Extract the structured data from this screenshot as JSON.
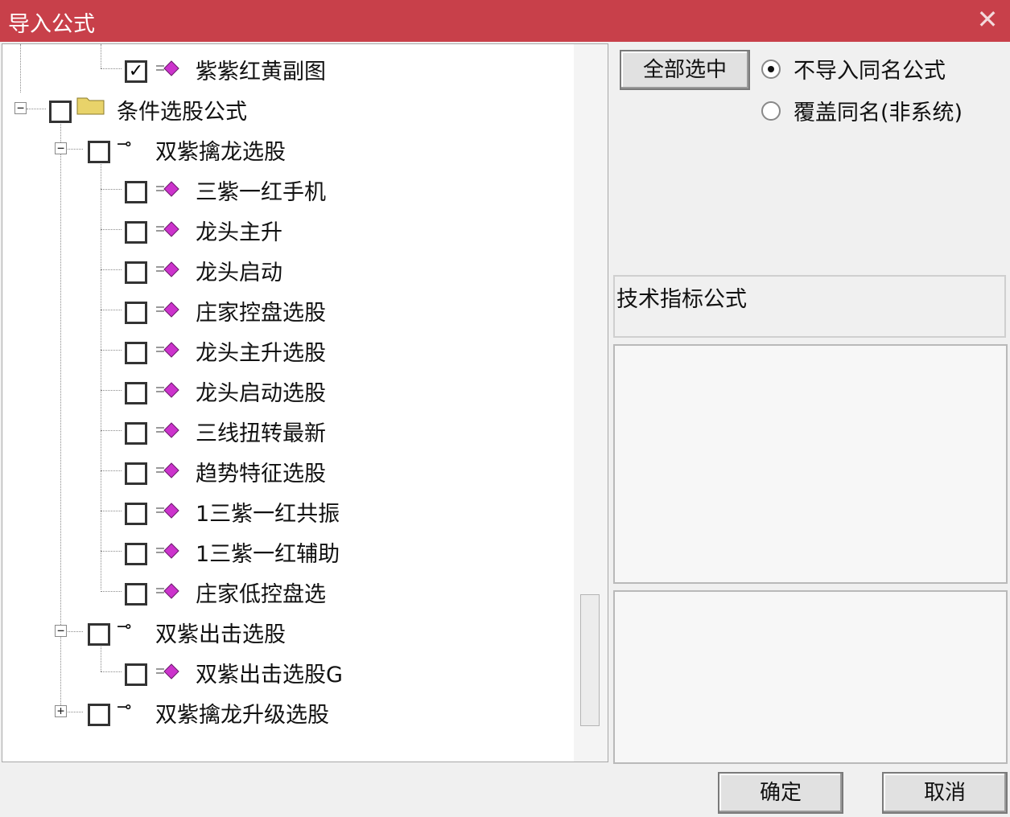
{
  "window": {
    "title": "导入公式",
    "close_glyph": "✕"
  },
  "tree": {
    "items": [
      {
        "label": "紫紫红黄副图",
        "checked": true,
        "icon": "formula-icon"
      },
      {
        "label": "条件选股公式",
        "checked": false,
        "icon": "folder-icon",
        "expander": "−"
      },
      {
        "label": "双紫擒龙选股",
        "checked": false,
        "icon": "key-icon",
        "expander": "−"
      },
      {
        "label": "三紫一红手机",
        "checked": false,
        "icon": "formula-icon"
      },
      {
        "label": "龙头主升",
        "checked": false,
        "icon": "formula-icon"
      },
      {
        "label": "龙头启动",
        "checked": false,
        "icon": "formula-icon"
      },
      {
        "label": "庄家控盘选股",
        "checked": false,
        "icon": "formula-icon"
      },
      {
        "label": "龙头主升选股",
        "checked": false,
        "icon": "formula-icon"
      },
      {
        "label": "龙头启动选股",
        "checked": false,
        "icon": "formula-icon"
      },
      {
        "label": "三线扭转最新",
        "checked": false,
        "icon": "formula-icon"
      },
      {
        "label": "趋势特征选股",
        "checked": false,
        "icon": "formula-icon"
      },
      {
        "label": "1三紫一红共振",
        "checked": false,
        "icon": "formula-icon"
      },
      {
        "label": "1三紫一红辅助",
        "checked": false,
        "icon": "formula-icon"
      },
      {
        "label": "庄家低控盘选",
        "checked": false,
        "icon": "formula-icon"
      },
      {
        "label": "双紫出击选股",
        "checked": false,
        "icon": "key-icon",
        "expander": "−"
      },
      {
        "label": "双紫出击选股G",
        "checked": false,
        "icon": "formula-icon"
      },
      {
        "label": "双紫擒龙升级选股",
        "checked": false,
        "icon": "key-icon",
        "expander": "+"
      }
    ],
    "check_glyph": "✓",
    "key_glyph": "⊸"
  },
  "controls": {
    "select_all_label": "全部选中",
    "radio_no_import_label": "不导入同名公式",
    "radio_overwrite_label": "覆盖同名(非系统)",
    "selected_radio": "不导入同名公式"
  },
  "info": {
    "type_text": "技术指标公式"
  },
  "footer": {
    "ok_label": "确定",
    "cancel_label": "取消"
  },
  "colors": {
    "titlebar": "#c8404a",
    "gem": "#cc33cc",
    "folder": "#e8d36a"
  }
}
